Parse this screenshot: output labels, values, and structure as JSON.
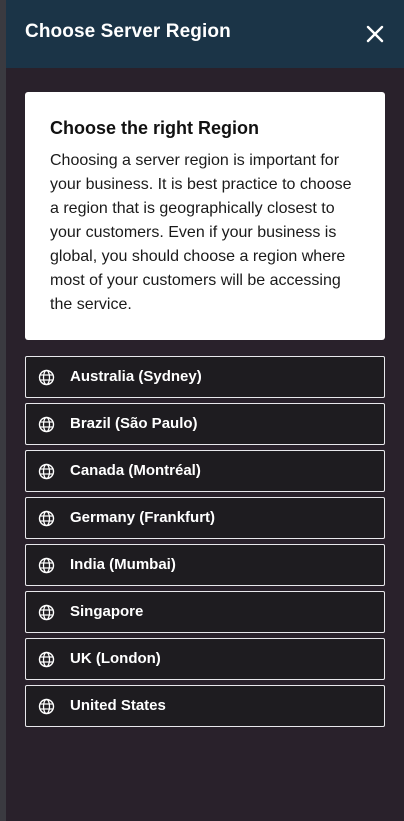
{
  "dialog": {
    "title": "Choose Server Region",
    "close_icon": "close-icon"
  },
  "info": {
    "title": "Choose the right Region",
    "body": "Choosing a server region is important for your business. It is best practice to choose a region that is geographically closest to your customers. Even if your business is global, you should choose a region where most of your customers will be accessing the service."
  },
  "regions": [
    {
      "label": "Australia (Sydney)",
      "icon": "globe-icon"
    },
    {
      "label": "Brazil (São Paulo)",
      "icon": "globe-icon"
    },
    {
      "label": "Canada (Montréal)",
      "icon": "globe-icon"
    },
    {
      "label": "Germany (Frankfurt)",
      "icon": "globe-icon"
    },
    {
      "label": "India (Mumbai)",
      "icon": "globe-icon"
    },
    {
      "label": "Singapore",
      "icon": "globe-icon"
    },
    {
      "label": "UK (London)",
      "icon": "globe-icon"
    },
    {
      "label": "United States",
      "icon": "globe-icon"
    }
  ],
  "colors": {
    "header_bg": "#1b3447",
    "panel_bg": "#29212b",
    "item_bg": "#1e1c20",
    "item_border": "#e8e8ec",
    "card_bg": "#ffffff"
  }
}
